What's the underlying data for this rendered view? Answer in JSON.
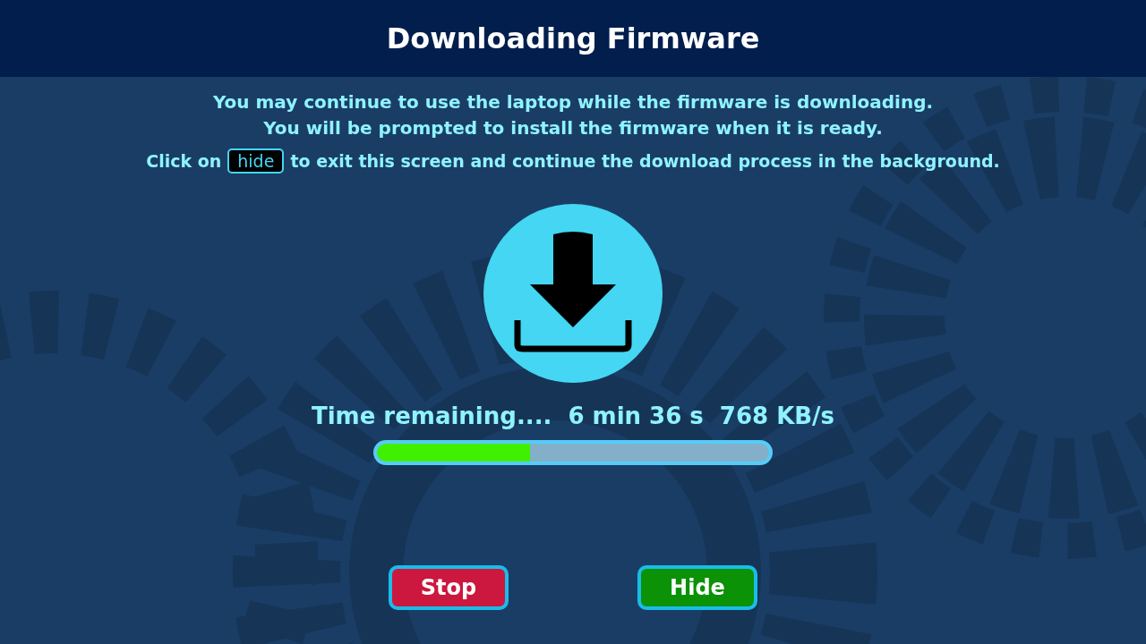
{
  "header": {
    "title": "Downloading Firmware"
  },
  "message": {
    "lines": [
      "You may continue to use the laptop while the firmware is downloading.",
      "You will be prompted to install the firmware when it is ready."
    ],
    "hint_before": "Click on",
    "hint_key": "hide",
    "hint_after": "to exit this screen and continue the download process in the background."
  },
  "status": {
    "label": "Time remaining....",
    "time": "6 min 36 s",
    "speed": "768 KB/s"
  },
  "progress": {
    "level": 0.39
  },
  "buttons": [
    {
      "label": "Stop",
      "color": "#cc173e"
    },
    {
      "label": "Hide",
      "color": "#0b9207"
    }
  ]
}
